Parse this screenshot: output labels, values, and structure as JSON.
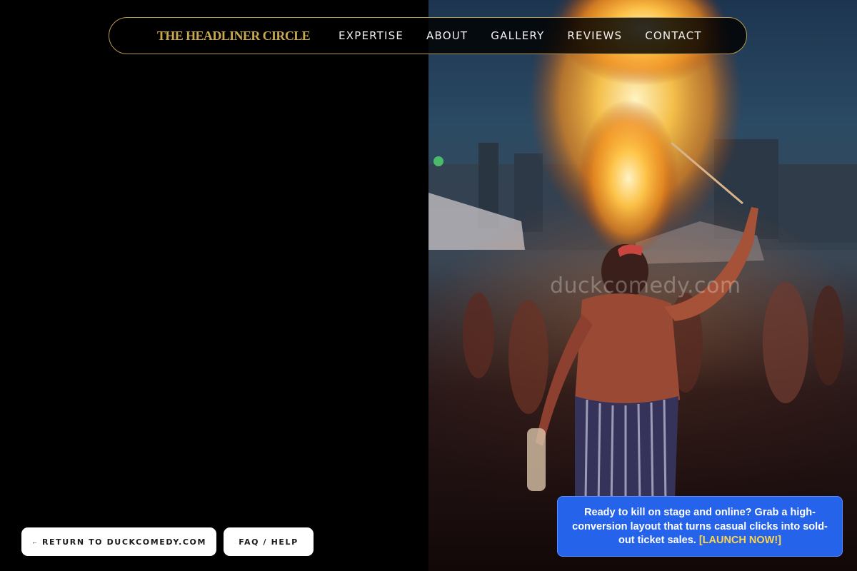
{
  "brand": {
    "name": "THE HEADLINER CIRCLE",
    "color": "#c9a94f"
  },
  "nav": {
    "links": [
      "EXPERTISE",
      "ABOUT",
      "GALLERY",
      "REVIEWS",
      "CONTACT"
    ]
  },
  "hero": {
    "watermark": "duckcomedy.com"
  },
  "footer_buttons": {
    "return_arrow": "←",
    "return_label": "RETURN TO DUCKCOMEDY.COM",
    "faq_label": "FAQ / HELP"
  },
  "promo": {
    "text": "Ready to kill on stage and online? Grab a high-conversion layout that turns casual clicks into sold-out ticket sales.",
    "cta": "[LAUNCH NOW!]",
    "background": "#2563eb",
    "cta_color": "#ffd54a"
  }
}
